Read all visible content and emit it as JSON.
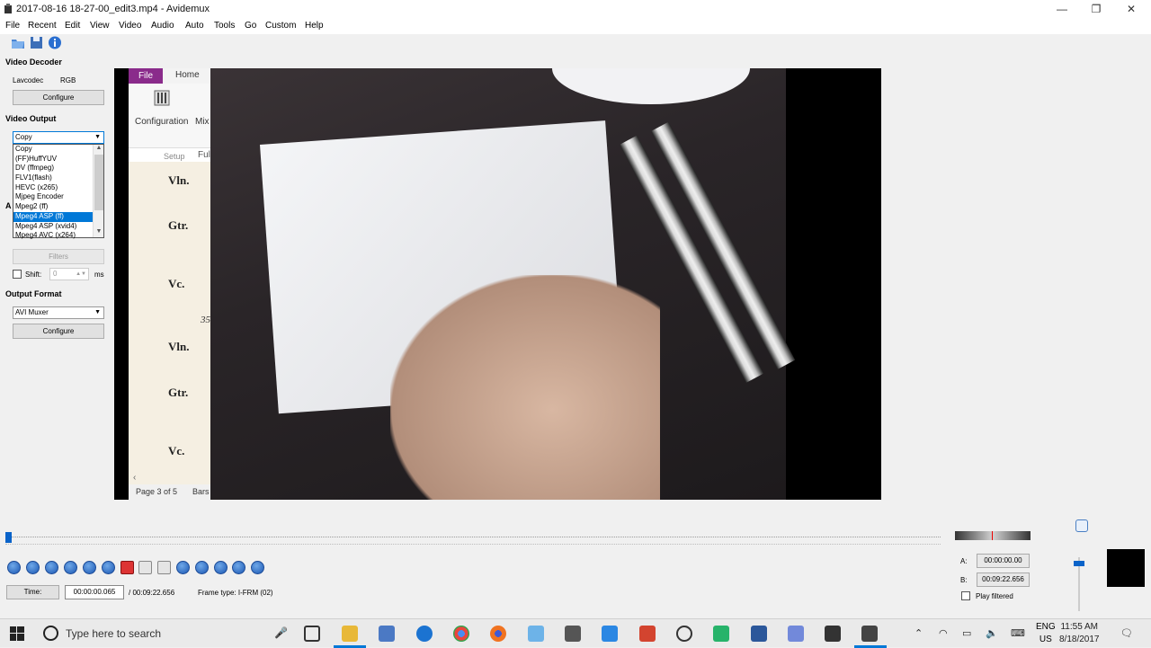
{
  "window": {
    "title": "2017-08-16 18-27-00_edit3.mp4 - Avidemux",
    "minimize": "—",
    "restore": "❐",
    "close": "✕"
  },
  "menu": [
    "File",
    "Recent",
    "Edit",
    "View",
    "Video",
    "Audio",
    "Auto",
    "Tools",
    "Go",
    "Custom",
    "Help"
  ],
  "left_panel": {
    "video_decoder": {
      "title": "Video Decoder",
      "codec": "Lavcodec",
      "colorspace": "RGB",
      "configure": "Configure"
    },
    "video_output": {
      "title": "Video Output",
      "selected": "Copy",
      "options": [
        "Copy",
        "(FF)HuffYUV",
        "DV (ffmpeg)",
        "FLV1(flash)",
        "HEVC (x265)",
        "Mjpeg Encoder",
        "Mpeg2 (ff)",
        "Mpeg4 ASP (ff)",
        "Mpeg4 ASP (xvid4)",
        "Mpeg4 AVC (x264)"
      ],
      "highlighted_index": 7
    },
    "audio_output_cut": "A",
    "filters": "Filters",
    "shift": {
      "label": "Shift:",
      "value": "0",
      "unit": "ms"
    },
    "output_format": {
      "title": "Output Format",
      "selected": "AVI Muxer",
      "configure": "Configure"
    }
  },
  "preview": {
    "doc": {
      "file_tab": "File",
      "home_tab": "Home",
      "configuration": "Configuration",
      "mix_cut": "Mix",
      "setup": "Setup",
      "ful_cut": "Ful",
      "instruments": [
        "Vln.",
        "Gtr.",
        "Vc.",
        "Vln.",
        "Gtr.",
        "Vc."
      ],
      "measure": "35",
      "status": "Page 3 of 5",
      "status2": "Bars"
    }
  },
  "bottom": {
    "time_label": "Time:",
    "current_time": "00:00:00.065",
    "total_time": "/ 00:09:22.656",
    "frame_type": "Frame type: I-FRM (02)",
    "a_label": "A:",
    "a_value": "00:00:00.00",
    "b_label": "B:",
    "b_value": "00:09:22.656",
    "play_filtered": "Play filtered"
  },
  "taskbar": {
    "search_placeholder": "Type here to search",
    "lang_top": "ENG",
    "lang_bottom": "US",
    "time": "11:55 AM",
    "date": "8/18/2017"
  }
}
